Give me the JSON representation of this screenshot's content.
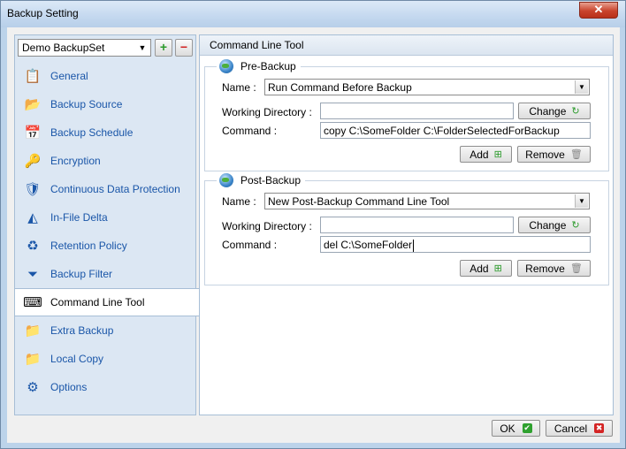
{
  "window": {
    "title": "Backup Setting",
    "close_glyph": "✕"
  },
  "backupset": {
    "selected": "Demo BackupSet",
    "add_glyph": "+",
    "remove_glyph": "−"
  },
  "sidebar": {
    "items": [
      {
        "label": "General",
        "icon": "general-icon",
        "glyph": "📋"
      },
      {
        "label": "Backup Source",
        "icon": "folder-icon",
        "glyph": "📂"
      },
      {
        "label": "Backup Schedule",
        "icon": "schedule-icon",
        "glyph": "📅"
      },
      {
        "label": "Encryption",
        "icon": "key-icon",
        "glyph": "🔑"
      },
      {
        "label": "Continuous Data Protection",
        "icon": "shield-icon",
        "glyph": "🛡"
      },
      {
        "label": "In-File Delta",
        "icon": "delta-icon",
        "glyph": "◭"
      },
      {
        "label": "Retention Policy",
        "icon": "recycle-icon",
        "glyph": "♻"
      },
      {
        "label": "Backup Filter",
        "icon": "filter-icon",
        "glyph": "⏷"
      },
      {
        "label": "Command Line Tool",
        "icon": "command-line-icon",
        "glyph": "⌨"
      },
      {
        "label": "Extra Backup",
        "icon": "extra-backup-icon",
        "glyph": "📁"
      },
      {
        "label": "Local Copy",
        "icon": "local-copy-icon",
        "glyph": "📁"
      },
      {
        "label": "Options",
        "icon": "options-icon",
        "glyph": "⚙"
      }
    ],
    "selected_index": 8
  },
  "main": {
    "header": "Command Line Tool",
    "pre": {
      "legend": "Pre-Backup",
      "name_label": "Name :",
      "name_value": "Run Command Before Backup",
      "wd_label": "Working Directory :",
      "wd_value": "",
      "cmd_label": "Command :",
      "cmd_value": "copy C:\\SomeFolder C:\\FolderSelectedForBackup",
      "change_label": "Change",
      "add_label": "Add",
      "remove_label": "Remove"
    },
    "post": {
      "legend": "Post-Backup",
      "name_label": "Name :",
      "name_value": "New Post-Backup Command Line Tool",
      "wd_label": "Working Directory :",
      "wd_value": "",
      "cmd_label": "Command :",
      "cmd_value": "del C:\\SomeFolder",
      "change_label": "Change",
      "add_label": "Add",
      "remove_label": "Remove"
    }
  },
  "footer": {
    "ok_label": "OK",
    "cancel_label": "Cancel"
  },
  "icons": {
    "refresh": "↻",
    "add": "⊞",
    "trash": "🗑",
    "ok": "✔",
    "cancel": "✖",
    "dropdown": "▼"
  },
  "colors": {
    "nav_text": "#1a56a8",
    "accent": "#bcd3ea"
  }
}
